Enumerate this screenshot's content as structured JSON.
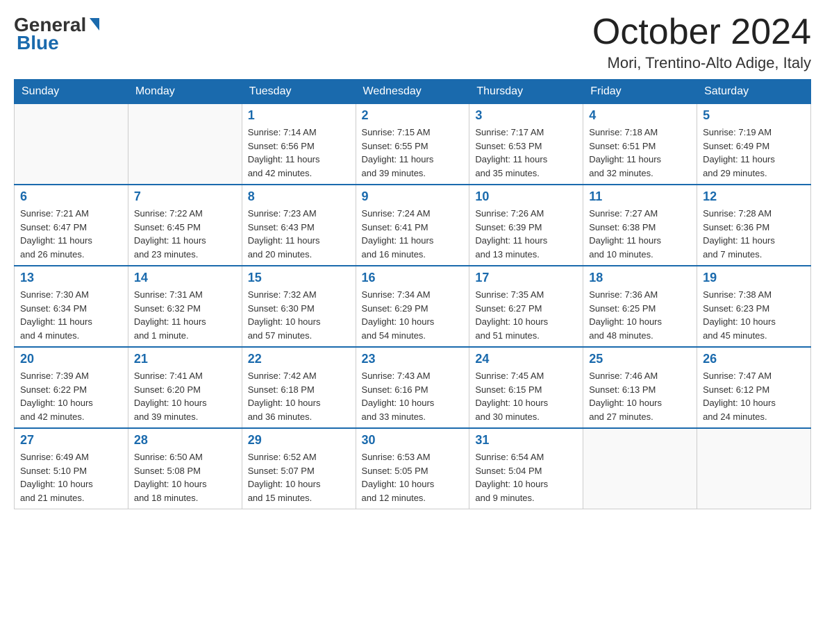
{
  "header": {
    "logo_general": "General",
    "logo_blue": "Blue",
    "month_year": "October 2024",
    "location": "Mori, Trentino-Alto Adige, Italy"
  },
  "days_of_week": [
    "Sunday",
    "Monday",
    "Tuesday",
    "Wednesday",
    "Thursday",
    "Friday",
    "Saturday"
  ],
  "weeks": [
    [
      {
        "day": "",
        "info": ""
      },
      {
        "day": "",
        "info": ""
      },
      {
        "day": "1",
        "info": "Sunrise: 7:14 AM\nSunset: 6:56 PM\nDaylight: 11 hours\nand 42 minutes."
      },
      {
        "day": "2",
        "info": "Sunrise: 7:15 AM\nSunset: 6:55 PM\nDaylight: 11 hours\nand 39 minutes."
      },
      {
        "day": "3",
        "info": "Sunrise: 7:17 AM\nSunset: 6:53 PM\nDaylight: 11 hours\nand 35 minutes."
      },
      {
        "day": "4",
        "info": "Sunrise: 7:18 AM\nSunset: 6:51 PM\nDaylight: 11 hours\nand 32 minutes."
      },
      {
        "day": "5",
        "info": "Sunrise: 7:19 AM\nSunset: 6:49 PM\nDaylight: 11 hours\nand 29 minutes."
      }
    ],
    [
      {
        "day": "6",
        "info": "Sunrise: 7:21 AM\nSunset: 6:47 PM\nDaylight: 11 hours\nand 26 minutes."
      },
      {
        "day": "7",
        "info": "Sunrise: 7:22 AM\nSunset: 6:45 PM\nDaylight: 11 hours\nand 23 minutes."
      },
      {
        "day": "8",
        "info": "Sunrise: 7:23 AM\nSunset: 6:43 PM\nDaylight: 11 hours\nand 20 minutes."
      },
      {
        "day": "9",
        "info": "Sunrise: 7:24 AM\nSunset: 6:41 PM\nDaylight: 11 hours\nand 16 minutes."
      },
      {
        "day": "10",
        "info": "Sunrise: 7:26 AM\nSunset: 6:39 PM\nDaylight: 11 hours\nand 13 minutes."
      },
      {
        "day": "11",
        "info": "Sunrise: 7:27 AM\nSunset: 6:38 PM\nDaylight: 11 hours\nand 10 minutes."
      },
      {
        "day": "12",
        "info": "Sunrise: 7:28 AM\nSunset: 6:36 PM\nDaylight: 11 hours\nand 7 minutes."
      }
    ],
    [
      {
        "day": "13",
        "info": "Sunrise: 7:30 AM\nSunset: 6:34 PM\nDaylight: 11 hours\nand 4 minutes."
      },
      {
        "day": "14",
        "info": "Sunrise: 7:31 AM\nSunset: 6:32 PM\nDaylight: 11 hours\nand 1 minute."
      },
      {
        "day": "15",
        "info": "Sunrise: 7:32 AM\nSunset: 6:30 PM\nDaylight: 10 hours\nand 57 minutes."
      },
      {
        "day": "16",
        "info": "Sunrise: 7:34 AM\nSunset: 6:29 PM\nDaylight: 10 hours\nand 54 minutes."
      },
      {
        "day": "17",
        "info": "Sunrise: 7:35 AM\nSunset: 6:27 PM\nDaylight: 10 hours\nand 51 minutes."
      },
      {
        "day": "18",
        "info": "Sunrise: 7:36 AM\nSunset: 6:25 PM\nDaylight: 10 hours\nand 48 minutes."
      },
      {
        "day": "19",
        "info": "Sunrise: 7:38 AM\nSunset: 6:23 PM\nDaylight: 10 hours\nand 45 minutes."
      }
    ],
    [
      {
        "day": "20",
        "info": "Sunrise: 7:39 AM\nSunset: 6:22 PM\nDaylight: 10 hours\nand 42 minutes."
      },
      {
        "day": "21",
        "info": "Sunrise: 7:41 AM\nSunset: 6:20 PM\nDaylight: 10 hours\nand 39 minutes."
      },
      {
        "day": "22",
        "info": "Sunrise: 7:42 AM\nSunset: 6:18 PM\nDaylight: 10 hours\nand 36 minutes."
      },
      {
        "day": "23",
        "info": "Sunrise: 7:43 AM\nSunset: 6:16 PM\nDaylight: 10 hours\nand 33 minutes."
      },
      {
        "day": "24",
        "info": "Sunrise: 7:45 AM\nSunset: 6:15 PM\nDaylight: 10 hours\nand 30 minutes."
      },
      {
        "day": "25",
        "info": "Sunrise: 7:46 AM\nSunset: 6:13 PM\nDaylight: 10 hours\nand 27 minutes."
      },
      {
        "day": "26",
        "info": "Sunrise: 7:47 AM\nSunset: 6:12 PM\nDaylight: 10 hours\nand 24 minutes."
      }
    ],
    [
      {
        "day": "27",
        "info": "Sunrise: 6:49 AM\nSunset: 5:10 PM\nDaylight: 10 hours\nand 21 minutes."
      },
      {
        "day": "28",
        "info": "Sunrise: 6:50 AM\nSunset: 5:08 PM\nDaylight: 10 hours\nand 18 minutes."
      },
      {
        "day": "29",
        "info": "Sunrise: 6:52 AM\nSunset: 5:07 PM\nDaylight: 10 hours\nand 15 minutes."
      },
      {
        "day": "30",
        "info": "Sunrise: 6:53 AM\nSunset: 5:05 PM\nDaylight: 10 hours\nand 12 minutes."
      },
      {
        "day": "31",
        "info": "Sunrise: 6:54 AM\nSunset: 5:04 PM\nDaylight: 10 hours\nand 9 minutes."
      },
      {
        "day": "",
        "info": ""
      },
      {
        "day": "",
        "info": ""
      }
    ]
  ]
}
